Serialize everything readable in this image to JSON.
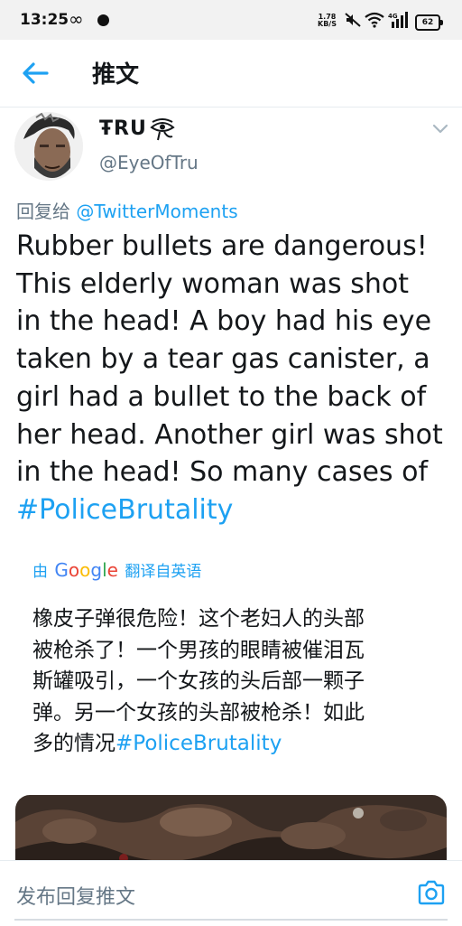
{
  "status_bar": {
    "time": "13:25",
    "loop_glyph": "∞",
    "net_speed_value": "1.78",
    "net_speed_unit": "KB/S",
    "signal_label": "4G",
    "battery": "62",
    "icons": [
      "mute-icon",
      "wifi-icon",
      "signal-icon",
      "battery-icon"
    ]
  },
  "header": {
    "title": "推文",
    "back_icon": "back-arrow-icon"
  },
  "tweet": {
    "author": {
      "display_name": "ŦRU",
      "name_emoji": "eye-of-horus-icon",
      "handle": "@EyeOfTru"
    },
    "reply_prefix": "回复给",
    "reply_to": "@TwitterMoments",
    "text_lines": [
      "Rubber bullets are dangerous!",
      "This elderly woman was shot",
      "in the head! A boy had his eye",
      "taken by a tear gas canister, a",
      "girl had a bullet to the back of",
      "her head. Another girl was shot",
      "in the head! So many cases  of"
    ],
    "hashtag": "#PoliceBrutality",
    "translation": {
      "prefix": "由",
      "provider_letters": [
        "G",
        "o",
        "o",
        "g",
        "l",
        "e"
      ],
      "suffix": "翻译自英语",
      "lines": [
        "橡皮子弹很危险！这个老妇人的头部",
        "被枪杀了！一个男孩的眼睛被催泪瓦",
        "斯罐吸引，一个女孩的头后部一颗子",
        "弹。另一个女孩的头部被枪杀！如此"
      ],
      "last_line_text": "多的情况",
      "last_line_hashtag": "#PoliceBrutality"
    }
  },
  "reply_bar": {
    "placeholder": "发布回复推文",
    "camera_icon": "camera-icon"
  },
  "colors": {
    "accent": "#1da1f2",
    "text": "#14171a",
    "secondary": "#657786",
    "divider": "#e6ecf0",
    "status_bar_bg": "#f2f2f2"
  }
}
